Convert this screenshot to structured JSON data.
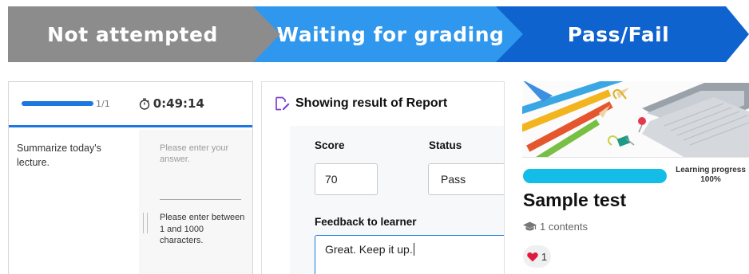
{
  "steps": [
    {
      "label": "Not attempted",
      "color": "#8c8c8c"
    },
    {
      "label": "Waiting for grading",
      "color": "#2f97ee"
    },
    {
      "label": "Pass/Fail",
      "color": "#0e63cf"
    }
  ],
  "test_panel": {
    "progress_fraction": 1.0,
    "progress_count": "1/1",
    "timer_icon": "stopwatch-icon",
    "timer": "0:49:14",
    "question": "Summarize today's lecture.",
    "answer_placeholder": "Please enter your answer.",
    "answer_hint": "Please enter between 1 and 1000 characters.",
    "accent_color": "#1a78e0"
  },
  "grading_panel": {
    "title_icon": "edit-document-icon",
    "title": "Showing result of Report",
    "score_label": "Score",
    "score_value": "70",
    "status_label": "Status",
    "status_value": "Pass",
    "feedback_label": "Feedback to learner",
    "feedback_value": "Great. Keep it up."
  },
  "course_card": {
    "learning_progress_label": "Learning progress",
    "learning_progress_value": "100%",
    "progress_fraction": 1.0,
    "title": "Sample test",
    "contents_icon": "graduation-cap-icon",
    "contents": "1 contents",
    "like_icon": "heart-icon",
    "likes": "1",
    "progress_color": "#13bde8"
  }
}
